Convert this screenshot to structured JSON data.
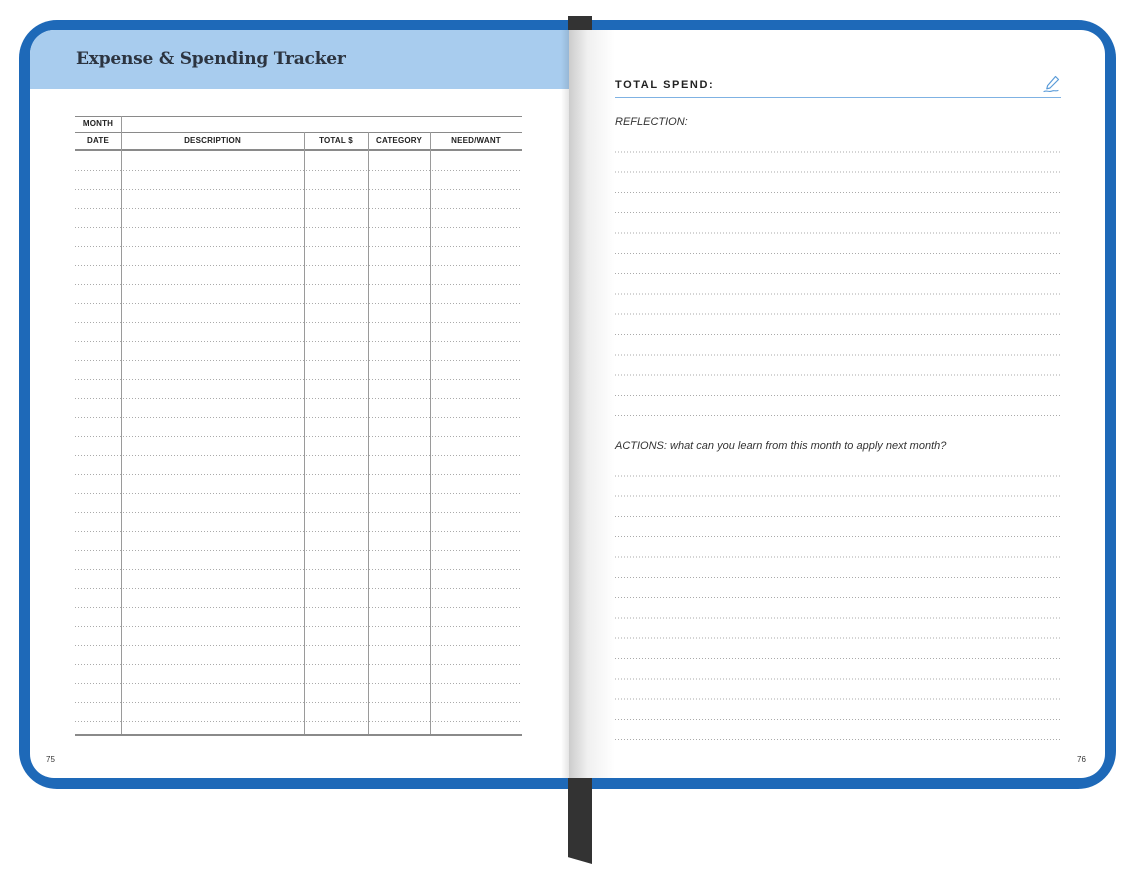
{
  "left_page": {
    "title": "Expense & Spending Tracker",
    "page_number": "75",
    "table": {
      "month_label": "MONTH",
      "columns": [
        "DATE",
        "DESCRIPTION",
        "TOTAL $",
        "CATEGORY",
        "NEED/WANT"
      ]
    }
  },
  "right_page": {
    "total_spend_label": "TOTAL SPEND:",
    "reflection_label": "REFLECTION:",
    "actions_label": "ACTIONS: what can you learn from this month to apply next month?",
    "page_number": "76",
    "icon": "pen-writing-icon"
  },
  "colors": {
    "cover": "#1e69b8",
    "header_band": "#a8ccee",
    "ribbon": "#333333",
    "accent_line": "#7fb2e3"
  }
}
